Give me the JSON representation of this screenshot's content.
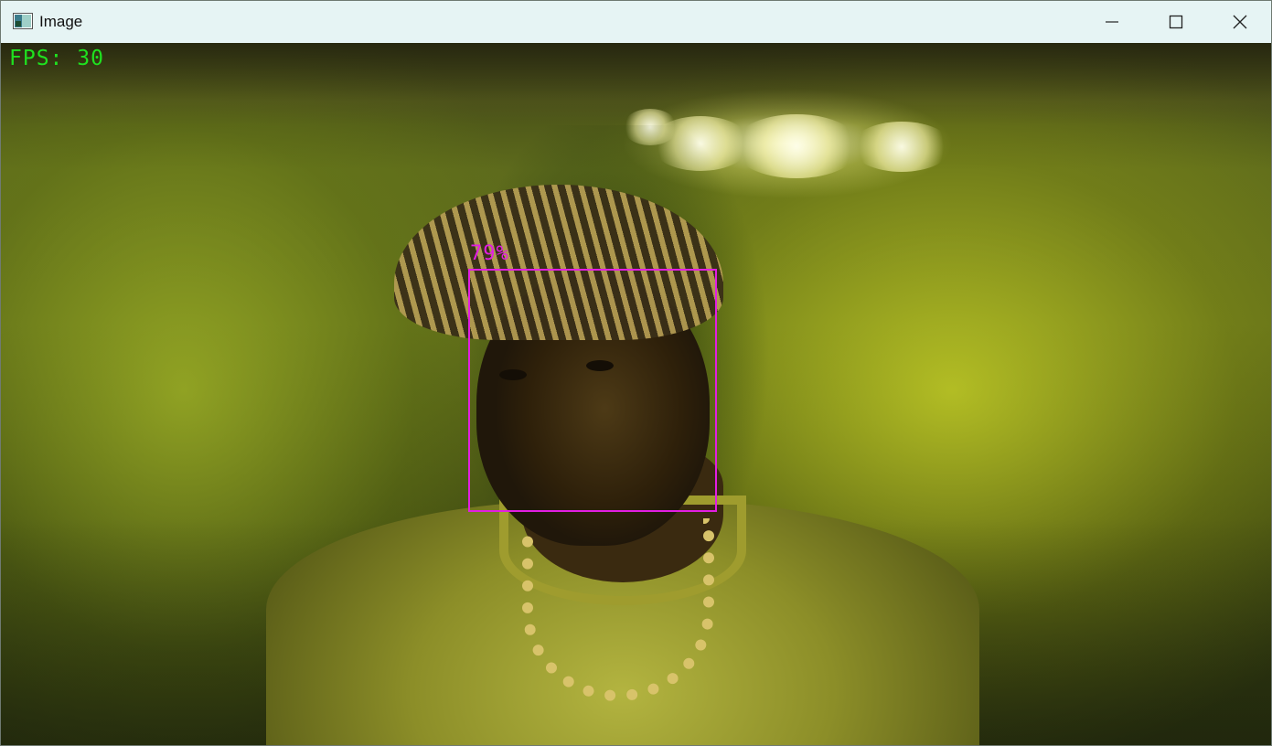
{
  "window": {
    "title": "Image",
    "icon": "image-window-icon",
    "controls": {
      "minimize_icon": "minimize-icon",
      "maximize_icon": "maximize-icon",
      "close_icon": "close-icon"
    }
  },
  "overlay": {
    "fps_text": "FPS: 30",
    "fps_color": "#1fe11f",
    "detections": [
      {
        "label": "79%",
        "color": "#e21ee2"
      }
    ]
  }
}
